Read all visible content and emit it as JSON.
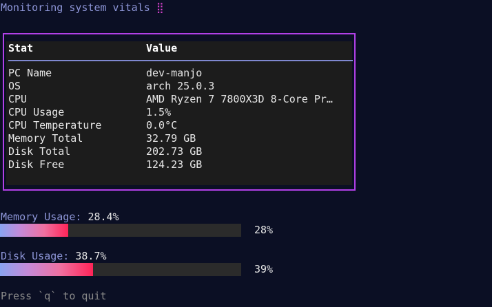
{
  "header": {
    "title": "Monitoring system vitals",
    "spinner": "⣿"
  },
  "table": {
    "columns": [
      "Stat",
      "Value"
    ],
    "rows": [
      {
        "stat": "PC Name",
        "value": "dev-manjo"
      },
      {
        "stat": "OS",
        "value": "arch 25.0.3"
      },
      {
        "stat": "CPU",
        "value": "AMD Ryzen 7 7800X3D 8-Core Pr…"
      },
      {
        "stat": "CPU Usage",
        "value": "1.5%"
      },
      {
        "stat": "CPU Temperature",
        "value": "0.0°C"
      },
      {
        "stat": "Memory Total",
        "value": "32.79 GB"
      },
      {
        "stat": "Disk Total",
        "value": "202.73 GB"
      },
      {
        "stat": "Disk Free",
        "value": "124.23 GB"
      }
    ]
  },
  "memory": {
    "label": "Memory Usage:",
    "value": "28.4%",
    "bar_fraction": 0.284,
    "bar_text": "28%"
  },
  "disk": {
    "label": "Disk Usage:",
    "value": "38.7%",
    "bar_fraction": 0.387,
    "bar_text": "39%"
  },
  "footer": {
    "hint": "Press `q` to quit"
  },
  "colors": {
    "background": "#0b0f24",
    "panel_border": "#b240e8",
    "panel_fill": "#1c1c1c",
    "accent_text": "#8e96d8",
    "bar_gradient_start": "#8aa4f0",
    "bar_gradient_end": "#ff2458",
    "bar_track": "#2b2b2b"
  }
}
